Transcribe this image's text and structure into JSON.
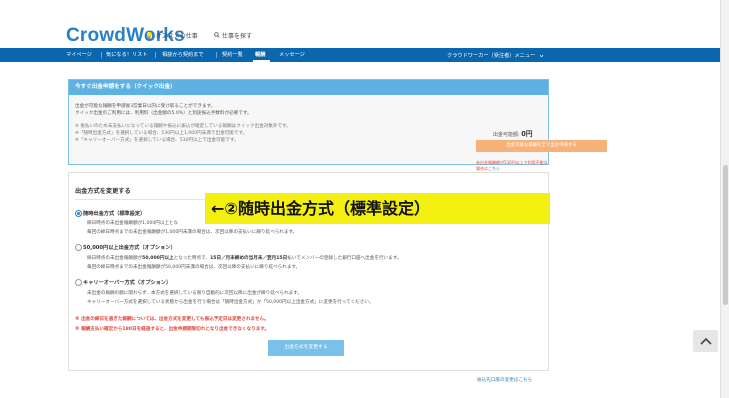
{
  "header": {
    "logo": "CrowdWorks",
    "recommended": "オススメの仕事",
    "search_jobs": "仕事を探す"
  },
  "nav": {
    "items": [
      "マイページ",
      "気になる！リスト",
      "相談から契約まで",
      "契約一覧",
      "報酬",
      "メッセージ"
    ],
    "user_menu": "クラウドワーカー（受注者）メニュー"
  },
  "quick": {
    "title": "今すぐ出金申請をする（クイック出金）",
    "line1": "出金が可能な報酬を申請後3営業日以内に受け取ることができます。",
    "line2": "クイック出金のご利用には、利用料（出金額の5.0%）と別途振込手数料が必要です。",
    "note1": "※ 後払いのため未支払いになっている報酬や振込に振込が確定している報酬はクイック出金対象外です。",
    "note2": "※「随時出金方式」を選択している場合、530円以上1,000円未満で出金可能です。",
    "note3": "※「キャリーオーバー方式」を選択している場合、530円以上で出金可能です。",
    "available_label": "出金可能額:",
    "available_amount": "0円",
    "button": "出金可能な報酬を全て出金申請する",
    "warning": "未出金報酬額が530円以上で利用不能な場合は",
    "warning_link": "こちら"
  },
  "method": {
    "title": "出金方式を変更する",
    "opt1": {
      "label": "随時出金方式（標準設定）",
      "line1": "締日時点の未出金報酬額が1,000円以上とな",
      "line2": "毎回の締日時点までの未出金報酬額が1,000円未満の場合は、次回以降の支払いに繰り延べられます。"
    },
    "opt2": {
      "label": "50,000円以上出金方式（オプション）",
      "line1_a": "締日時点の未出金報酬額が",
      "line1_b": "50,000円以上",
      "line1_c": "となった時点で、",
      "line1_d": "15日／月末締めの当月末／翌月15日",
      "line1_e": "払いでメンバーの登録した銀行口座へ出金を行います。",
      "line2": "毎回の締日時点までの未出金報酬額が50,000円未満の場合は、次回以降の支払いに繰り延べられます。"
    },
    "opt3": {
      "label": "キャリーオーバー方式（オプション）",
      "line1": "未出金の報酬の額に関わらず、本方式を選択している限り自動的に次回以降に出金が繰り延べられます。",
      "line2": "キャリーオーバー方式を選択している状態から出金を行う場合は「随時出金方式」か「50,000円以上出金方式」に変更を行ってください。"
    },
    "note_red1": "※ 出金の締日を過ぎた報酬については、出金方式を変更しても振込予定日は変更されません。",
    "note_red2": "※ 報酬支払い確定から180日を経過すると、出金申請期限切れとなり出金できなくなります。",
    "button": "出金方式を変更する"
  },
  "callout": "←②随時出金方式（標準設定）",
  "bottom_link": "振込先口座の変更はこちら"
}
